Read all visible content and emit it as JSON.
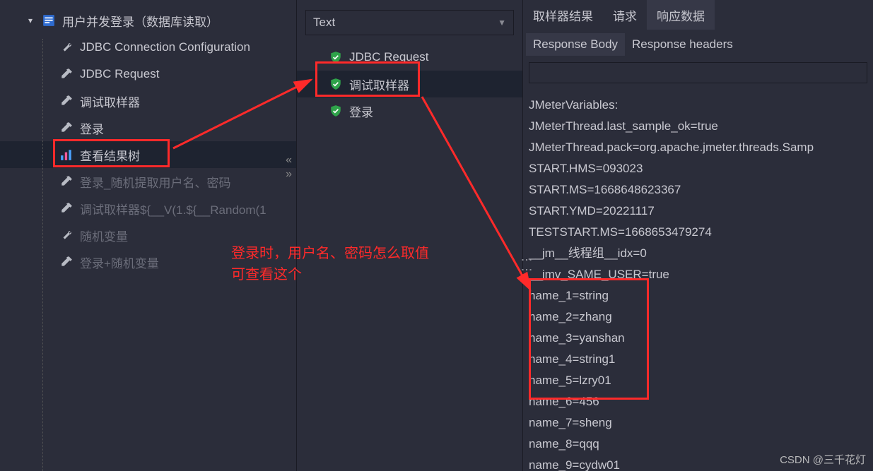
{
  "leftTree": {
    "root": "用户并发登录（数据库读取）",
    "items": [
      {
        "label": "JDBC Connection Configuration",
        "icon": "wrench"
      },
      {
        "label": "JDBC Request",
        "icon": "dropper"
      },
      {
        "label": "调试取样器",
        "icon": "dropper"
      },
      {
        "label": "登录",
        "icon": "dropper"
      },
      {
        "label": "查看结果树",
        "icon": "chart",
        "selected": true
      },
      {
        "label": "登录_随机提取用户名、密码",
        "icon": "dropper",
        "disabled": true
      },
      {
        "label": "调试取样器${__V(1.${__Random(1",
        "icon": "dropper",
        "disabled": true
      },
      {
        "label": "随机变量",
        "icon": "wrench",
        "disabled": true
      },
      {
        "label": "登录+随机变量",
        "icon": "dropper",
        "disabled": true
      }
    ]
  },
  "middle": {
    "dropdown": "Text",
    "results": [
      {
        "label": "JDBC Request"
      },
      {
        "label": "调试取样器",
        "selected": true
      },
      {
        "label": "登录"
      }
    ]
  },
  "right": {
    "tabs": [
      "取样器结果",
      "请求",
      "响应数据"
    ],
    "activeTab": 2,
    "subtabs": [
      "Response Body",
      "Response headers"
    ],
    "activeSubtab": 0,
    "responseLines": [
      "JMeterVariables:",
      "JMeterThread.last_sample_ok=true",
      "JMeterThread.pack=org.apache.jmeter.threads.Samp",
      "START.HMS=093023",
      "START.MS=1668648623367",
      "START.YMD=20221117",
      "TESTSTART.MS=1668653479274",
      "__jm__线程组__idx=0",
      "__jmv_SAME_USER=true",
      "name_1=string",
      "name_2=zhang",
      "name_3=yanshan",
      "name_4=string1",
      "name_5=lzry01",
      "name_6=456",
      "name_7=sheng",
      "name_8=qqq",
      "name_9=cydw01"
    ]
  },
  "annotation": {
    "line1": "登录时，用户名、密码怎么取值",
    "line2": "可查看这个"
  },
  "watermark": "CSDN @三千花灯"
}
